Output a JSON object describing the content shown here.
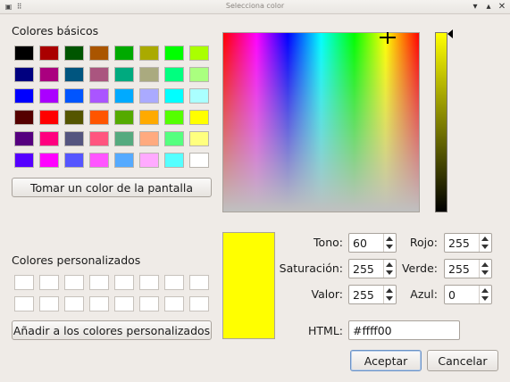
{
  "window": {
    "title": "Selecciona color"
  },
  "titlebar_icons": {
    "app": "window-icon",
    "pin": "grip-icon",
    "minimize": "minimize-icon",
    "maximize": "maximize-icon",
    "close": "close-icon"
  },
  "basic_colors": {
    "label": "Colores básicos",
    "rows": [
      [
        "#000000",
        "#aa0000",
        "#005500",
        "#aa5500",
        "#00aa00",
        "#aaaa00",
        "#00ff00",
        "#aaff00"
      ],
      [
        "#00007f",
        "#aa007f",
        "#00557f",
        "#aa557f",
        "#00aa7f",
        "#aaaa7f",
        "#00ff7f",
        "#aaff7f"
      ],
      [
        "#0000ff",
        "#aa00ff",
        "#0055ff",
        "#aa55ff",
        "#00aaff",
        "#aaaaff",
        "#00ffff",
        "#aaffff"
      ],
      [
        "#550000",
        "#ff0000",
        "#555500",
        "#ff5500",
        "#55aa00",
        "#ffaa00",
        "#55ff00",
        "#ffff00"
      ],
      [
        "#55007f",
        "#ff007f",
        "#55557f",
        "#ff557f",
        "#55aa7f",
        "#ffaa7f",
        "#55ff7f",
        "#ffff7f"
      ],
      [
        "#5500ff",
        "#ff00ff",
        "#5555ff",
        "#ff55ff",
        "#55aaff",
        "#ffaaff",
        "#55ffff",
        "#ffffff"
      ]
    ]
  },
  "pick_screen_button": "Tomar un color de la pantalla",
  "custom_colors": {
    "label": "Colores personalizados",
    "slots": [
      "#ffffff",
      "#ffffff",
      "#ffffff",
      "#ffffff",
      "#ffffff",
      "#ffffff",
      "#ffffff",
      "#ffffff",
      "#ffffff",
      "#ffffff",
      "#ffffff",
      "#ffffff",
      "#ffffff",
      "#ffffff",
      "#ffffff",
      "#ffffff"
    ]
  },
  "add_custom_button": "Añadir a los colores personalizados",
  "fields": {
    "hue": {
      "label": "Tono:",
      "value": "60"
    },
    "saturation": {
      "label": "Saturación:",
      "value": "255"
    },
    "value": {
      "label": "Valor:",
      "value": "255"
    },
    "red": {
      "label": "Rojo:",
      "value": "255"
    },
    "green": {
      "label": "Verde:",
      "value": "255"
    },
    "blue": {
      "label": "Azul:",
      "value": "0"
    },
    "html": {
      "label": "HTML:",
      "value": "#ffff00"
    }
  },
  "current_color": "#ffff00",
  "buttons": {
    "accept": "Aceptar",
    "cancel": "Cancelar"
  }
}
